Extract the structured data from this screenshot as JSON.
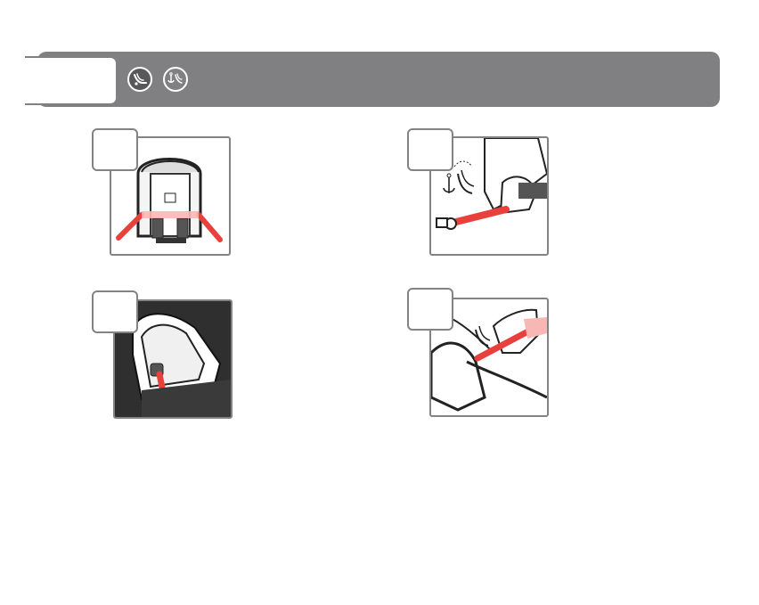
{
  "header": {
    "icons": [
      "isofix-car-seat-icon",
      "anchor-car-seat-icon"
    ],
    "bar_color": "#808083"
  },
  "steps": [
    {
      "icon": "car-seat-rear-view-illustration"
    },
    {
      "icon": "isofix-connector-hand-illustration"
    },
    {
      "icon": "car-seat-side-view-illustration"
    },
    {
      "icon": "vehicle-seat-connector-illustration"
    }
  ],
  "accent_color": "#e8413d"
}
